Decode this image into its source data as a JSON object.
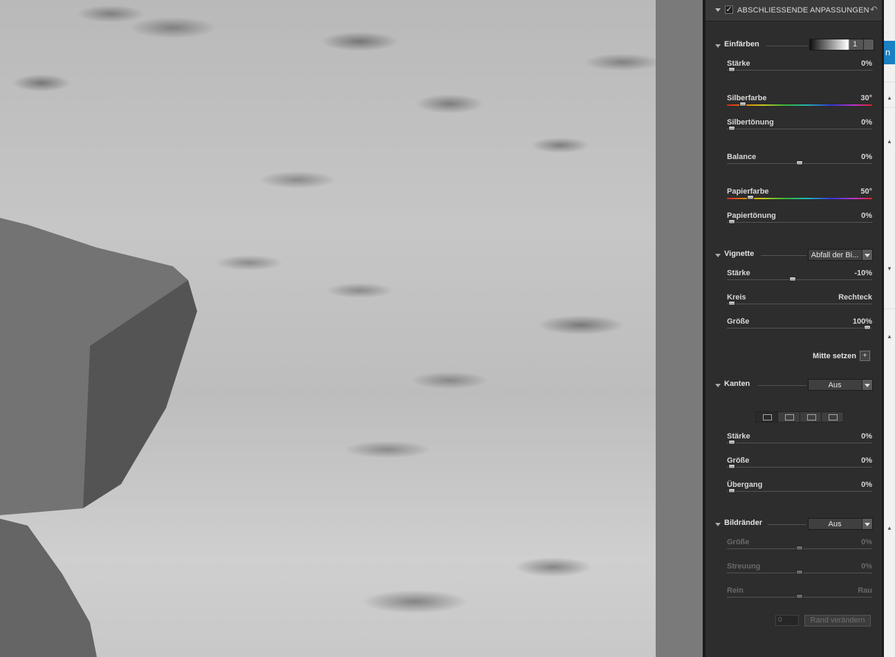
{
  "panel": {
    "title": "ABSCHLIESSENDE ANPASSUNGEN",
    "checked": true,
    "icons": {
      "reset": "undo-icon",
      "collapse": "triangle-down-icon"
    }
  },
  "einfaerben": {
    "label": "Einfärben",
    "preset_value": "1",
    "rows": [
      {
        "name": "Stärke",
        "value": "0%",
        "level": 0
      },
      {
        "name": "Silberfarbe",
        "value": "30°",
        "level": 0.08
      },
      {
        "name": "Silbertönung",
        "value": "0%",
        "level": 0
      },
      {
        "name": "Balance",
        "value": "0%",
        "level": 0.5
      },
      {
        "name": "Papierfarbe",
        "value": "50°",
        "level": 0.14
      },
      {
        "name": "Papiertönung",
        "value": "0%",
        "level": 0
      }
    ]
  },
  "vignette": {
    "label": "Vignette",
    "dropdown": "Abfall der Bi...",
    "rows": [
      {
        "name": "Stärke",
        "value": "-10%",
        "level": 0.45
      },
      {
        "name": "Kreis",
        "value": "Rechteck",
        "level": 0
      },
      {
        "name": "Größe",
        "value": "100%",
        "level": 1
      }
    ],
    "center_button": "Mitte setzen"
  },
  "kanten": {
    "label": "Kanten",
    "dropdown": "Aus",
    "rows": [
      {
        "name": "Stärke",
        "value": "0%",
        "level": 0
      },
      {
        "name": "Größe",
        "value": "0%",
        "level": 0
      },
      {
        "name": "Übergang",
        "value": "0%",
        "level": 0
      }
    ]
  },
  "bildraender": {
    "label": "Bildränder",
    "dropdown": "Aus",
    "rows": [
      {
        "name": "Größe",
        "value": "0%",
        "level": 0.5
      },
      {
        "name": "Streuung",
        "value": "0%",
        "level": 0.5
      },
      {
        "name": "Rein",
        "value": "Rau",
        "level": 0.5
      }
    ],
    "input_value": "0",
    "button": "Rand verändern"
  },
  "right_strip": {
    "tab_letter": "n"
  }
}
